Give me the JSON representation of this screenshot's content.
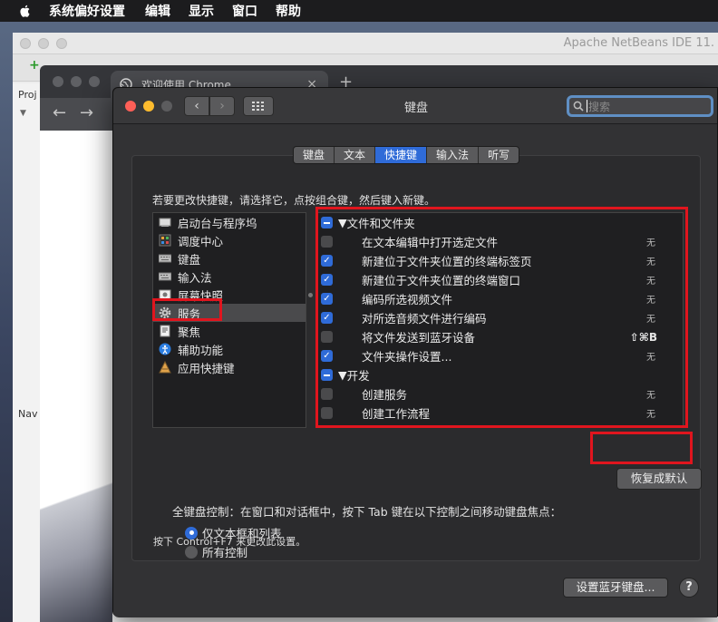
{
  "menubar": {
    "items": [
      "系统偏好设置",
      "编辑",
      "显示",
      "窗口",
      "帮助"
    ]
  },
  "netbeans": {
    "title": "Apache NetBeans IDE 11.",
    "panel_top": "Proj",
    "panel_bottom": "Nav"
  },
  "chrome": {
    "tab_title": "欢迎使用 Chrome",
    "tab_close": "×",
    "new_tab": "+"
  },
  "prefs": {
    "window_title": "键盘",
    "search_placeholder": "搜索",
    "tabs": [
      {
        "label": "键盘",
        "selected": false
      },
      {
        "label": "文本",
        "selected": false
      },
      {
        "label": "快捷键",
        "selected": true
      },
      {
        "label": "输入法",
        "selected": false
      },
      {
        "label": "听写",
        "selected": false
      }
    ],
    "instruction": "若要更改快捷键，请选择它，点按组合键，然后键入新键。",
    "categories": [
      {
        "label": "启动台与程序坞",
        "icon": "launchpad-icon"
      },
      {
        "label": "调度中心",
        "icon": "mission-control-icon"
      },
      {
        "label": "键盘",
        "icon": "keyboard-icon"
      },
      {
        "label": "输入法",
        "icon": "input-method-icon"
      },
      {
        "label": "屏幕快照",
        "icon": "screenshot-icon"
      },
      {
        "label": "服务",
        "icon": "gear-icon",
        "selected": true
      },
      {
        "label": "聚焦",
        "icon": "spotlight-icon"
      },
      {
        "label": "辅助功能",
        "icon": "accessibility-icon"
      },
      {
        "label": "应用快捷键",
        "icon": "app-shortcuts-icon"
      }
    ],
    "shortcuts": [
      {
        "type": "group",
        "label": "文件和文件夹",
        "state": "mixed"
      },
      {
        "type": "item",
        "label": "在文本编辑中打开选定文件",
        "checked": false,
        "key": "无"
      },
      {
        "type": "item",
        "label": "新建位于文件夹位置的终端标签页",
        "checked": true,
        "key": "无"
      },
      {
        "type": "item",
        "label": "新建位于文件夹位置的终端窗口",
        "checked": true,
        "key": "无"
      },
      {
        "type": "item",
        "label": "编码所选视频文件",
        "checked": true,
        "key": "无"
      },
      {
        "type": "item",
        "label": "对所选音频文件进行编码",
        "checked": true,
        "key": "无"
      },
      {
        "type": "item",
        "label": "将文件发送到蓝牙设备",
        "checked": false,
        "key": "⇧⌘B"
      },
      {
        "type": "item",
        "label": "文件夹操作设置...",
        "checked": true,
        "key": "无"
      },
      {
        "type": "group",
        "label": "开发",
        "state": "mixed"
      },
      {
        "type": "item",
        "label": "创建服务",
        "checked": false,
        "key": "无"
      },
      {
        "type": "item",
        "label": "创建工作流程",
        "checked": false,
        "key": "无"
      }
    ],
    "restore_label": "恢复成默认",
    "keyboard_control_label": "全键盘控制：在窗口和对话框中，按下 Tab 键在以下控制之间移动键盘焦点：",
    "radio_text_only": "仅文本框和列表",
    "radio_all": "所有控制",
    "note": "按下 Control+F7 来更改此设置。",
    "bluetooth_button": "设置蓝牙键盘...",
    "help_label": "?"
  },
  "colors": {
    "accent": "#2f6bd8",
    "highlight_box": "#e0151e"
  }
}
